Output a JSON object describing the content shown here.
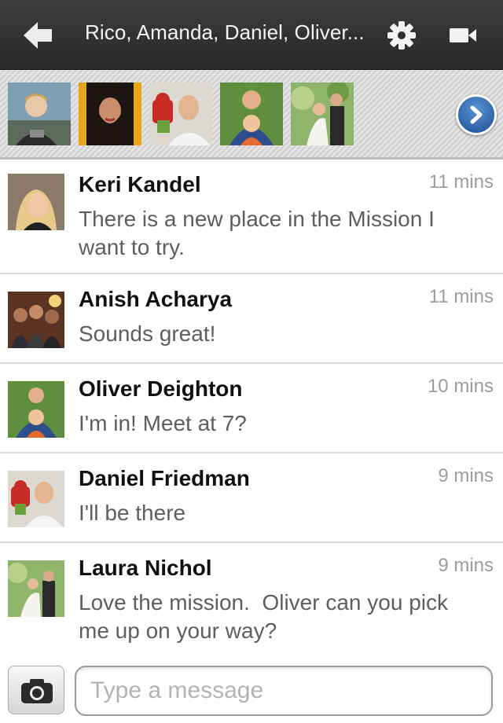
{
  "header": {
    "title": "Rico, Amanda, Daniel, Oliver...",
    "back_icon": "back-arrow-icon",
    "settings_icon": "gear-icon",
    "video_icon": "video-camera-icon"
  },
  "participants": [
    {
      "photo": "person-photo"
    },
    {
      "photo": "person-photo"
    },
    {
      "photo": "person-photo"
    },
    {
      "photo": "person-photo"
    },
    {
      "photo": "person-photo"
    }
  ],
  "strip_next_icon": "chevron-right-icon",
  "messages": [
    {
      "name": "Keri Kandel",
      "time": "11 mins",
      "text": "There is a new place in the Mission I want to try."
    },
    {
      "name": "Anish Acharya",
      "time": "11 mins",
      "text": "Sounds great!"
    },
    {
      "name": "Oliver Deighton",
      "time": "10 mins",
      "text": "I'm in! Meet at 7?"
    },
    {
      "name": "Daniel Friedman",
      "time": "9 mins",
      "text": "I'll be there"
    },
    {
      "name": "Laura Nichol",
      "time": "9 mins",
      "text": "Love the mission.  Oliver can you pick me up on your way?"
    }
  ],
  "composer": {
    "camera_icon": "camera-icon",
    "placeholder": "Type a message",
    "value": ""
  },
  "colors": {
    "header_bg": "#2f3032",
    "accent_blue": "#2a63ad",
    "meta_gray": "#9c9c9c"
  }
}
